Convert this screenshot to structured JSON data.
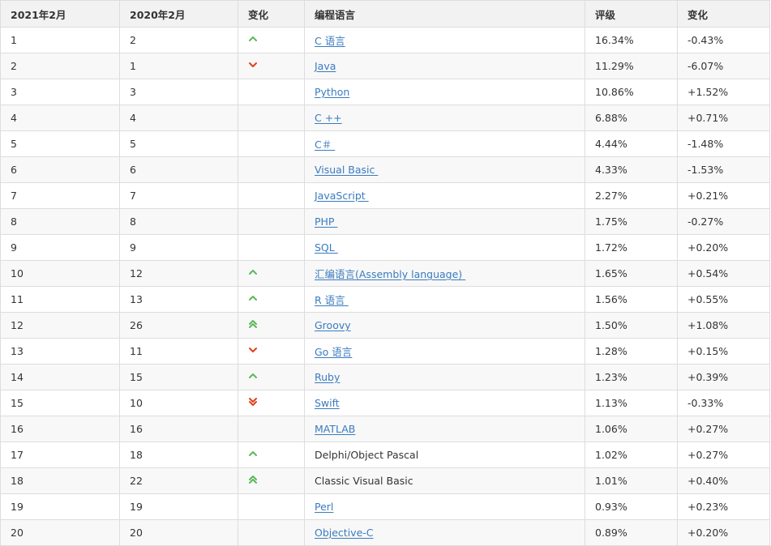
{
  "colors": {
    "up": "#5cb85c",
    "down": "#e0401c",
    "link": "#3a7bbf",
    "header_bg": "#f2f2f2",
    "stripe_bg": "#f8f8f8",
    "border": "#dddddd"
  },
  "table": {
    "headers": {
      "rank_2021": "2021年2月",
      "rank_2020": "2020年2月",
      "change_arrow": "变化",
      "language": "编程语言",
      "rating": "评级",
      "change_pct": "变化"
    },
    "rows": [
      {
        "rank_2021": "1",
        "rank_2020": "2",
        "trend": "up",
        "trend_icon": "chevron-up-icon",
        "language": "C 语言",
        "is_link": true,
        "rating": "16.34%",
        "change": "-0.43%"
      },
      {
        "rank_2021": "2",
        "rank_2020": "1",
        "trend": "down",
        "trend_icon": "chevron-down-icon",
        "language": "Java",
        "is_link": true,
        "rating": "11.29%",
        "change": "-6.07%"
      },
      {
        "rank_2021": "3",
        "rank_2020": "3",
        "trend": "none",
        "trend_icon": "",
        "language": "Python",
        "is_link": true,
        "rating": "10.86%",
        "change": "+1.52%"
      },
      {
        "rank_2021": "4",
        "rank_2020": "4",
        "trend": "none",
        "trend_icon": "",
        "language": "C ++",
        "is_link": true,
        "rating": "6.88%",
        "change": "+0.71%"
      },
      {
        "rank_2021": "5",
        "rank_2020": "5",
        "trend": "none",
        "trend_icon": "",
        "language": "C＃ ",
        "is_link": true,
        "rating": "4.44%",
        "change": "-1.48%"
      },
      {
        "rank_2021": "6",
        "rank_2020": "6",
        "trend": "none",
        "trend_icon": "",
        "language": "Visual Basic ",
        "is_link": true,
        "rating": "4.33%",
        "change": "-1.53%"
      },
      {
        "rank_2021": "7",
        "rank_2020": "7",
        "trend": "none",
        "trend_icon": "",
        "language": "JavaScript ",
        "is_link": true,
        "rating": "2.27%",
        "change": "+0.21%"
      },
      {
        "rank_2021": "8",
        "rank_2020": "8",
        "trend": "none",
        "trend_icon": "",
        "language": "PHP ",
        "is_link": true,
        "rating": "1.75%",
        "change": "-0.27%"
      },
      {
        "rank_2021": "9",
        "rank_2020": "9",
        "trend": "none",
        "trend_icon": "",
        "language": "SQL ",
        "is_link": true,
        "rating": "1.72%",
        "change": "+0.20%"
      },
      {
        "rank_2021": "10",
        "rank_2020": "12",
        "trend": "up",
        "trend_icon": "chevron-up-icon",
        "language": "汇编语言(Assembly language) ",
        "is_link": true,
        "rating": "1.65%",
        "change": "+0.54%"
      },
      {
        "rank_2021": "11",
        "rank_2020": "13",
        "trend": "up",
        "trend_icon": "chevron-up-icon",
        "language": "R 语言 ",
        "is_link": true,
        "rating": "1.56%",
        "change": "+0.55%"
      },
      {
        "rank_2021": "12",
        "rank_2020": "26",
        "trend": "double-up",
        "trend_icon": "double-chevron-up-icon",
        "language": "Groovy",
        "is_link": true,
        "rating": "1.50%",
        "change": "+1.08%"
      },
      {
        "rank_2021": "13",
        "rank_2020": "11",
        "trend": "down",
        "trend_icon": "chevron-down-icon",
        "language": "Go 语言",
        "is_link": true,
        "rating": "1.28%",
        "change": "+0.15%"
      },
      {
        "rank_2021": "14",
        "rank_2020": "15",
        "trend": "up",
        "trend_icon": "chevron-up-icon",
        "language": "Ruby",
        "is_link": true,
        "rating": "1.23%",
        "change": "+0.39%"
      },
      {
        "rank_2021": "15",
        "rank_2020": "10",
        "trend": "double-down",
        "trend_icon": "double-chevron-down-icon",
        "language": "Swift",
        "is_link": true,
        "rating": "1.13%",
        "change": "-0.33%"
      },
      {
        "rank_2021": "16",
        "rank_2020": "16",
        "trend": "none",
        "trend_icon": "",
        "language": "MATLAB",
        "is_link": true,
        "rating": "1.06%",
        "change": "+0.27%"
      },
      {
        "rank_2021": "17",
        "rank_2020": "18",
        "trend": "up",
        "trend_icon": "chevron-up-icon",
        "language": "Delphi/Object Pascal",
        "is_link": false,
        "rating": "1.02%",
        "change": "+0.27%"
      },
      {
        "rank_2021": "18",
        "rank_2020": "22",
        "trend": "double-up",
        "trend_icon": "double-chevron-up-icon",
        "language": "Classic Visual Basic",
        "is_link": false,
        "rating": "1.01%",
        "change": "+0.40%"
      },
      {
        "rank_2021": "19",
        "rank_2020": "19",
        "trend": "none",
        "trend_icon": "",
        "language": "Perl",
        "is_link": true,
        "rating": "0.93%",
        "change": "+0.23%"
      },
      {
        "rank_2021": "20",
        "rank_2020": "20",
        "trend": "none",
        "trend_icon": "",
        "language": "Objective-C",
        "is_link": true,
        "rating": "0.89%",
        "change": "+0.20%"
      }
    ]
  }
}
